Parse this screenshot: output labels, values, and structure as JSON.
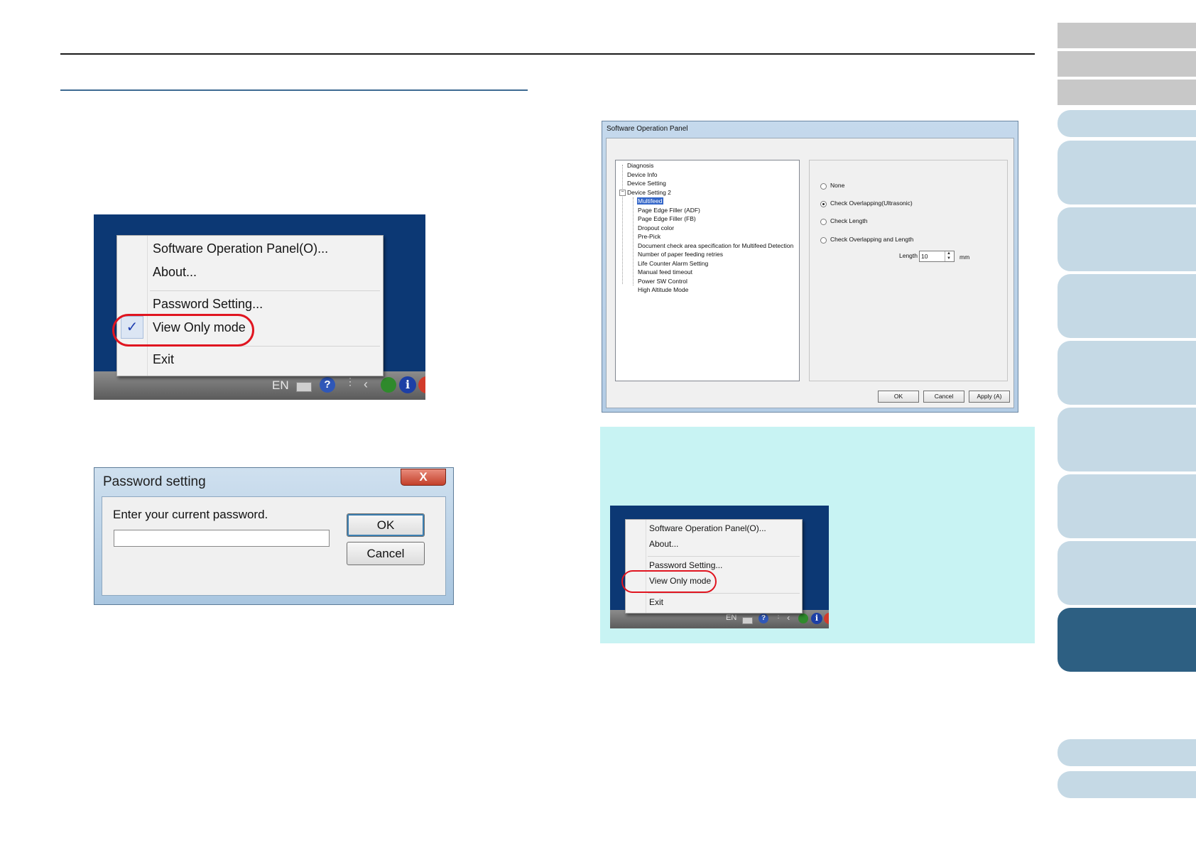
{
  "menu_large": {
    "items": [
      "Software Operation Panel(O)...",
      "About...",
      "Password Setting...",
      "View Only mode",
      "Exit"
    ],
    "checked_item": "View Only mode",
    "tray_language": "EN"
  },
  "password_dialog": {
    "title": "Password setting",
    "close_label": "X",
    "prompt": "Enter your current password.",
    "password_value": "",
    "ok_label": "OK",
    "cancel_label": "Cancel"
  },
  "software_panel": {
    "title": "Software Operation Panel",
    "tree": [
      {
        "label": "Diagnosis",
        "level": 0
      },
      {
        "label": "Device Info",
        "level": 0
      },
      {
        "label": "Device Setting",
        "level": 0
      },
      {
        "label": "Device Setting 2",
        "level": 0
      },
      {
        "label": "Multifeed",
        "level": 1,
        "selected": true
      },
      {
        "label": "Page Edge Filler (ADF)",
        "level": 1
      },
      {
        "label": "Page Edge Filler (FB)",
        "level": 1
      },
      {
        "label": "Dropout color",
        "level": 1
      },
      {
        "label": "Pre-Pick",
        "level": 1
      },
      {
        "label": "Document check area specification for Multifeed Detection",
        "level": 1
      },
      {
        "label": "Number of paper feeding retries",
        "level": 1
      },
      {
        "label": "Life Counter Alarm Setting",
        "level": 1
      },
      {
        "label": "Manual feed timeout",
        "level": 1
      },
      {
        "label": "Power SW Control",
        "level": 1
      },
      {
        "label": "High Altitude Mode",
        "level": 1
      }
    ],
    "options": [
      "None",
      "Check Overlapping(Ultrasonic)",
      "Check Length",
      "Check Overlapping and Length"
    ],
    "selected_option": "Check Overlapping(Ultrasonic)",
    "length_label": "Length",
    "length_value": "10",
    "length_unit": "mm",
    "ok_label": "OK",
    "cancel_label": "Cancel",
    "apply_label": "Apply (A)"
  },
  "menu_small": {
    "items": [
      "Software Operation Panel(O)...",
      "About...",
      "Password Setting...",
      "View Only mode",
      "Exit"
    ],
    "tray_language": "EN"
  },
  "colors": {
    "highlight": "#e01520",
    "note_background": "#c8f3f3",
    "tab_active": "#2d5f82",
    "tab_inactive": "#c5d9e5"
  }
}
